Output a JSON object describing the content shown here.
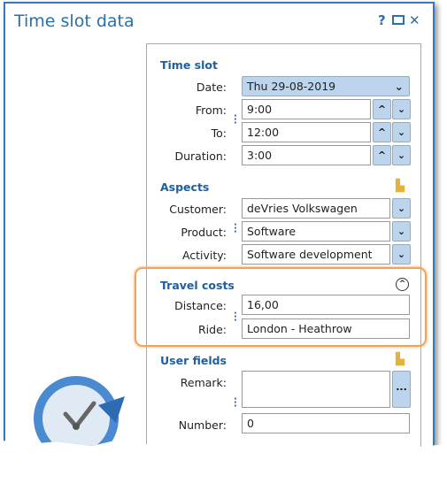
{
  "window": {
    "title": "Time slot data",
    "help": "?",
    "maximize_icon": "maximize-icon",
    "close": "✕"
  },
  "time_slot": {
    "header": "Time slot",
    "date": {
      "label": "Date:",
      "value": "Thu 29-08-2019"
    },
    "from": {
      "label": "From:",
      "value": "9:00"
    },
    "to": {
      "label": "To:",
      "value": "12:00"
    },
    "duration": {
      "label": "Duration:",
      "value": "3:00"
    }
  },
  "aspects": {
    "header": "Aspects",
    "customer": {
      "label": "Customer:",
      "value": "deVries Volkswagen"
    },
    "product": {
      "label": "Product:",
      "value": "Software"
    },
    "activity": {
      "label": "Activity:",
      "value": "Software development"
    }
  },
  "travel_costs": {
    "header": "Travel costs",
    "distance": {
      "label": "Distance:",
      "value": "16,00"
    },
    "ride": {
      "label": "Ride:",
      "value": "London - Heathrow"
    }
  },
  "user_fields": {
    "header": "User fields",
    "remark": {
      "label": "Remark:",
      "value": "",
      "button": "..."
    },
    "number": {
      "label": "Number:",
      "value": "0"
    }
  },
  "colors": {
    "accent": "#2f6ea6",
    "highlight": "#f0a35a",
    "button": "#bcd4ec"
  }
}
